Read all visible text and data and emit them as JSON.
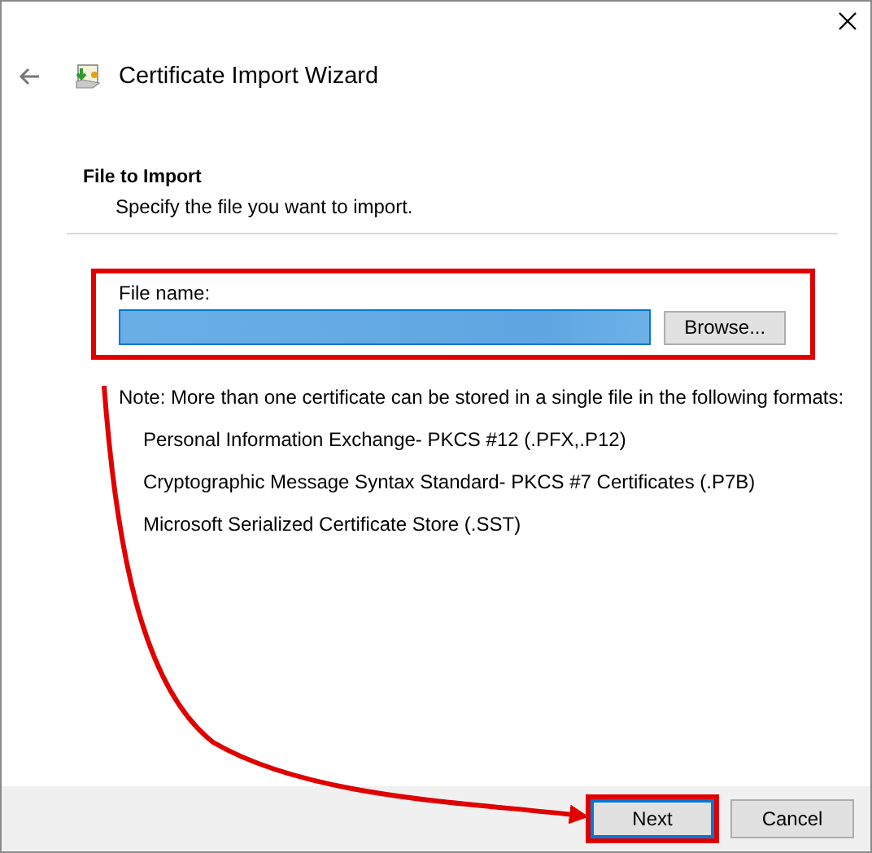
{
  "window": {
    "title": "Certificate Import Wizard"
  },
  "header": {
    "title": "File to Import",
    "subtitle": "Specify the file you want to import."
  },
  "file_field": {
    "label": "File name:",
    "browse_button": "Browse...",
    "highlighted": true
  },
  "note": "Note:  More than one certificate can be stored in a single file in the following formats:",
  "formats": [
    "Personal Information Exchange- PKCS #12 (.PFX,.P12)",
    "Cryptographic Message Syntax Standard- PKCS #7 Certificates (.P7B)",
    "Microsoft Serialized Certificate Store (.SST)"
  ],
  "buttons": [
    {
      "label": "Next",
      "kind": "default",
      "highlighted": true
    },
    {
      "label": "Cancel",
      "kind": "normal",
      "highlighted": false
    }
  ],
  "annotation_arrow": true
}
